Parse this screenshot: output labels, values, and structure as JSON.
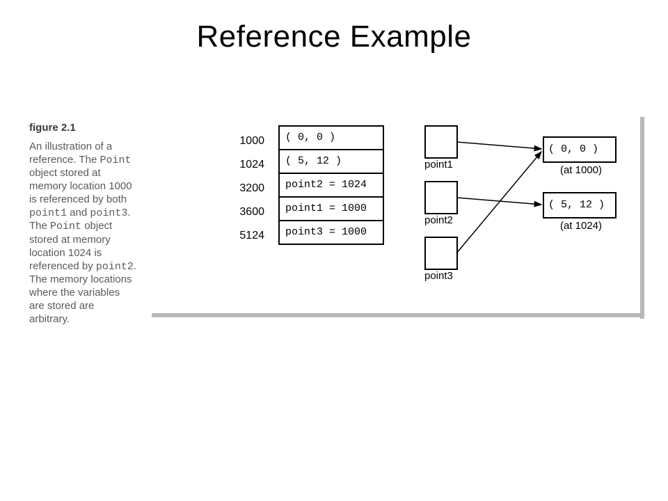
{
  "title": "Reference Example",
  "caption": {
    "label": "figure 2.1",
    "text_parts": [
      "An illustration of a reference. The ",
      "Point",
      " object stored at memory location 1000 is referenced by both ",
      "point1",
      " and ",
      "point3",
      ". The ",
      "Point",
      " object stored at memory location 1024 is referenced by ",
      "point2",
      ". The memory locations where the variables are stored are arbitrary."
    ]
  },
  "memory": {
    "rows": [
      {
        "addr": "1000",
        "content": "( 0, 0 )"
      },
      {
        "addr": "1024",
        "content": "( 5, 12 )"
      },
      {
        "addr": "3200",
        "content": "point2 = 1024"
      },
      {
        "addr": "3600",
        "content": "point1 = 1000"
      },
      {
        "addr": "5124",
        "content": "point3 = 1000"
      }
    ]
  },
  "refs": {
    "p1": "point1",
    "p2": "point2",
    "p3": "point3"
  },
  "values": {
    "v1": {
      "content": "( 0, 0 )",
      "label": "(at 1000)"
    },
    "v2": {
      "content": "( 5, 12 )",
      "label": "(at 1024)"
    }
  }
}
